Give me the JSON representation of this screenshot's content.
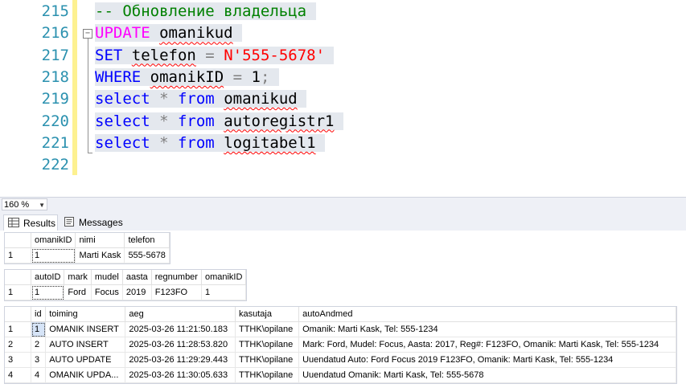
{
  "editor": {
    "lines": [
      {
        "num": "215",
        "segments": [
          {
            "cls": "cm",
            "text": "-- Обновление владельца"
          }
        ]
      },
      {
        "num": "216",
        "segments": [
          {
            "cls": "pink",
            "text": "UPDATE"
          },
          {
            "cls": "",
            "text": " "
          },
          {
            "cls": "obj",
            "text": "omanikud"
          }
        ]
      },
      {
        "num": "217",
        "segments": [
          {
            "cls": "kw",
            "text": "SET"
          },
          {
            "cls": "",
            "text": " "
          },
          {
            "cls": "obj",
            "text": "telefon"
          },
          {
            "cls": "gray",
            "text": " = "
          },
          {
            "cls": "str",
            "text": "N'555-5678'"
          }
        ]
      },
      {
        "num": "218",
        "segments": [
          {
            "cls": "kw",
            "text": "WHERE"
          },
          {
            "cls": "",
            "text": " "
          },
          {
            "cls": "obj",
            "text": "omanikID"
          },
          {
            "cls": "gray",
            "text": " = "
          },
          {
            "cls": "",
            "text": "1"
          },
          {
            "cls": "gray",
            "text": ";"
          }
        ]
      },
      {
        "num": "219",
        "segments": [
          {
            "cls": "kw",
            "text": "select"
          },
          {
            "cls": "gray",
            "text": " * "
          },
          {
            "cls": "kw",
            "text": "from"
          },
          {
            "cls": "",
            "text": " "
          },
          {
            "cls": "obj",
            "text": "omanikud"
          }
        ]
      },
      {
        "num": "220",
        "segments": [
          {
            "cls": "kw",
            "text": "select"
          },
          {
            "cls": "gray",
            "text": " * "
          },
          {
            "cls": "kw",
            "text": "from"
          },
          {
            "cls": "",
            "text": " "
          },
          {
            "cls": "obj",
            "text": "autoregistr1"
          }
        ]
      },
      {
        "num": "221",
        "segments": [
          {
            "cls": "kw",
            "text": "select"
          },
          {
            "cls": "gray",
            "text": " * "
          },
          {
            "cls": "kw",
            "text": "from"
          },
          {
            "cls": "",
            "text": " "
          },
          {
            "cls": "obj",
            "text": "logitabel1"
          }
        ]
      },
      {
        "num": "222",
        "segments": []
      }
    ],
    "fold_symbol": "−"
  },
  "zoom": {
    "value": "160 %"
  },
  "tabs": {
    "results": "Results",
    "messages": "Messages"
  },
  "grids": [
    {
      "columns": [
        "",
        "omanikID",
        "nimi",
        "telefon"
      ],
      "rows": [
        [
          "1",
          "1",
          "Marti Kask",
          "555-5678"
        ]
      ]
    },
    {
      "columns": [
        "",
        "autoID",
        "mark",
        "mudel",
        "aasta",
        "regnumber",
        "omanikID"
      ],
      "rows": [
        [
          "1",
          "1",
          "Ford",
          "Focus",
          "2019",
          "F123FO",
          "1"
        ]
      ]
    },
    {
      "columns": [
        "",
        "id",
        "toiming",
        "aeg",
        "kasutaja",
        "autoAndmed"
      ],
      "rows": [
        [
          "1",
          "1",
          "OMANIK INSERT",
          "2025-03-26 11:21:50.183",
          "TTHK\\opilane",
          "Omanik: Marti Kask, Tel: 555-1234"
        ],
        [
          "2",
          "2",
          "AUTO INSERT",
          "2025-03-26 11:28:53.820",
          "TTHK\\opilane",
          "Mark: Ford, Mudel: Focus, Aasta: 2017, Reg#: F123FO, Omanik: Marti Kask, Tel: 555-1234"
        ],
        [
          "3",
          "3",
          "AUTO UPDATE",
          "2025-03-26 11:29:29.443",
          "TTHK\\opilane",
          "Uuendatud Auto: Ford Focus 2019 F123FO, Omanik: Marti Kask, Tel: 555-1234"
        ],
        [
          "4",
          "4",
          "OMANIK UPDA...",
          "2025-03-26 11:30:05.633",
          "TTHK\\opilane",
          "Uuendatud Omanik: Marti Kask, Tel: 555-5678"
        ]
      ]
    }
  ]
}
